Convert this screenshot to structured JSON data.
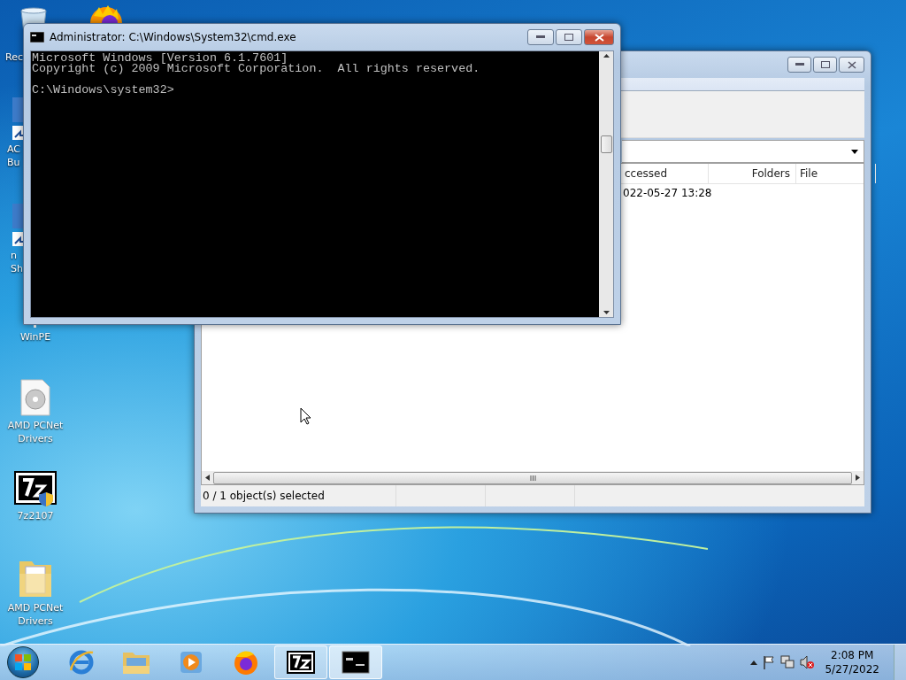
{
  "desktop_icons": [
    {
      "kind": "recycle",
      "lines": [
        "Rec"
      ]
    },
    {
      "kind": "firefox"
    },
    {
      "kind": "shortcut",
      "lines": [
        "AC",
        "Bu"
      ]
    },
    {
      "kind": "shortcut2",
      "lines": [
        "n",
        "Sh"
      ]
    },
    {
      "kind": "winpe",
      "lines": [
        "WinPE"
      ]
    },
    {
      "kind": "disc",
      "lines": [
        "AMD PCNet",
        "Drivers"
      ]
    },
    {
      "kind": "sevenzip",
      "lines": [
        "7z2107"
      ]
    },
    {
      "kind": "folder",
      "lines": [
        "AMD PCNet",
        "Drivers"
      ]
    }
  ],
  "archive_window": {
    "columns": [
      "ccessed",
      "Folders",
      "File"
    ],
    "rows": [
      [
        "022-05-27 13:28",
        "",
        ""
      ]
    ],
    "status_bar": "0 / 1 object(s) selected"
  },
  "cmd_window": {
    "title": "Administrator: C:\\Windows\\System32\\cmd.exe",
    "output": [
      "Microsoft Windows [Version 6.1.7601]",
      "Copyright (c) 2009 Microsoft Corporation.  All rights reserved."
    ],
    "prompt": "C:\\Windows\\system32>"
  },
  "taskbar": {
    "items": [
      {
        "kind": "ie",
        "running": false,
        "selected": false
      },
      {
        "kind": "explorer",
        "running": false,
        "selected": false
      },
      {
        "kind": "media",
        "running": false,
        "selected": false
      },
      {
        "kind": "firefox",
        "running": false,
        "selected": false
      },
      {
        "kind": "sevenzip",
        "running": true,
        "selected": false
      },
      {
        "kind": "cmd",
        "running": true,
        "selected": true
      }
    ],
    "clock": {
      "time": "2:08 PM",
      "date": "5/27/2022"
    }
  }
}
